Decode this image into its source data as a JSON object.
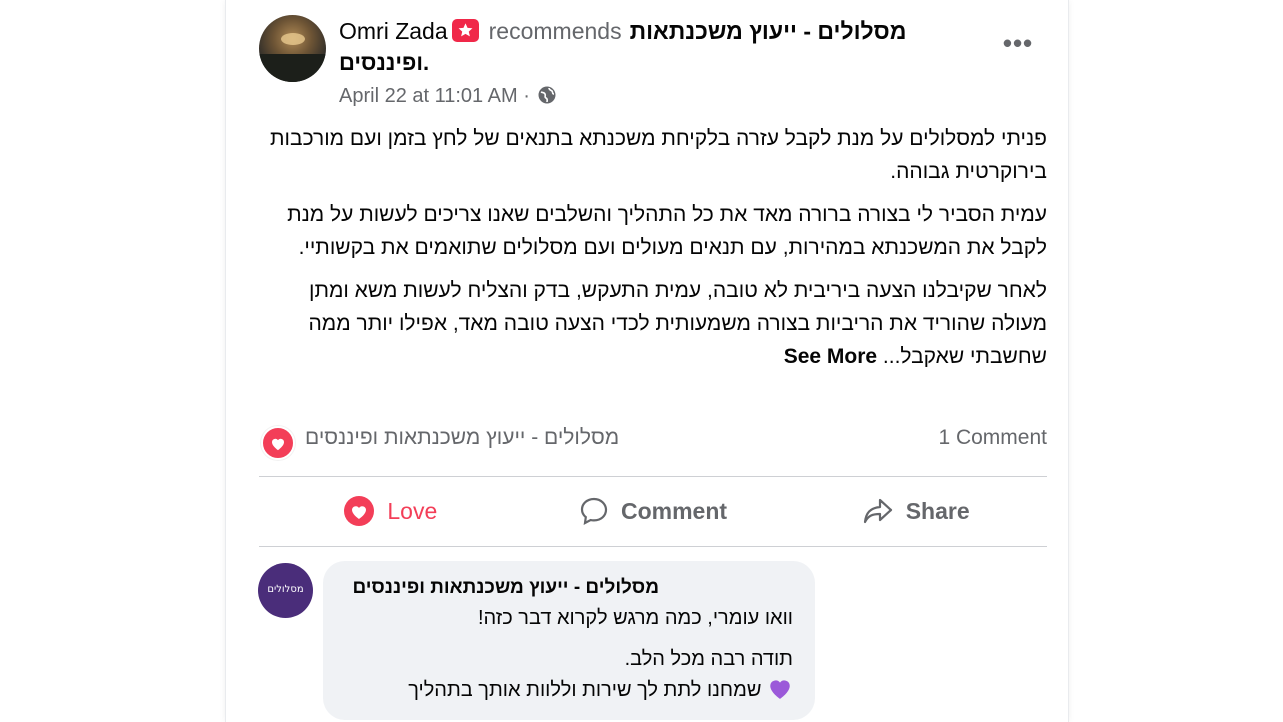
{
  "post": {
    "author": "Omri Zada",
    "recommends": "recommends",
    "page_name_line1": "מסלולים - ייעוץ משכנתאות",
    "page_name_line2": "ופיננסים.",
    "timestamp": "April 22 at 11:01 AM",
    "separator": "·",
    "more_label": "•••",
    "paragraphs": [
      "פניתי למסלולים על מנת לקבל עזרה בלקיחת משכנתא בתנאים של לחץ בזמן ועם מורכבות בירוקרטית גבוהה.",
      "עמית הסביר לי בצורה ברורה מאד את כל התהליך והשלבים שאנו צריכים לעשות על מנת לקבל את המשכנתא במהירות, עם תנאים מעולים ועם מסלולים שתואמים את בקשותיי.",
      "לאחר שקיבלנו הצעה ביריבית לא טובה, עמית התעקש, בדק והצליח לעשות משא ומתן מעולה שהוריד את הריביות בצורה משמעותית לכדי הצעה טובה מאד, אפילו יותר ממה שחשבתי שאקבל..."
    ],
    "see_more": "See More"
  },
  "reactions": {
    "reactor": "מסלולים - ייעוץ משכנתאות ופיננסים",
    "comment_count": "1 Comment"
  },
  "actions": {
    "love": "Love",
    "comment": "Comment",
    "share": "Share"
  },
  "comment": {
    "avatar_text": "מסלולים",
    "name": "מסלולים - ייעוץ משכנתאות ופיננסים",
    "lines": [
      "וואו עומרי, כמה מרגש לקרוא דבר כזה!",
      "תודה רבה מכל הלב.",
      "שמחנו לתת לך שירות וללוות אותך בתהליך"
    ]
  },
  "colors": {
    "love": "#f33e58",
    "secondary_text": "#65676b",
    "bubble_bg": "#f0f2f5",
    "page_avatar": "#4a2d7a"
  },
  "icons": [
    "recommend-badge-icon",
    "globe-icon",
    "heart-icon",
    "comment-icon",
    "share-icon",
    "purple-heart-icon"
  ]
}
